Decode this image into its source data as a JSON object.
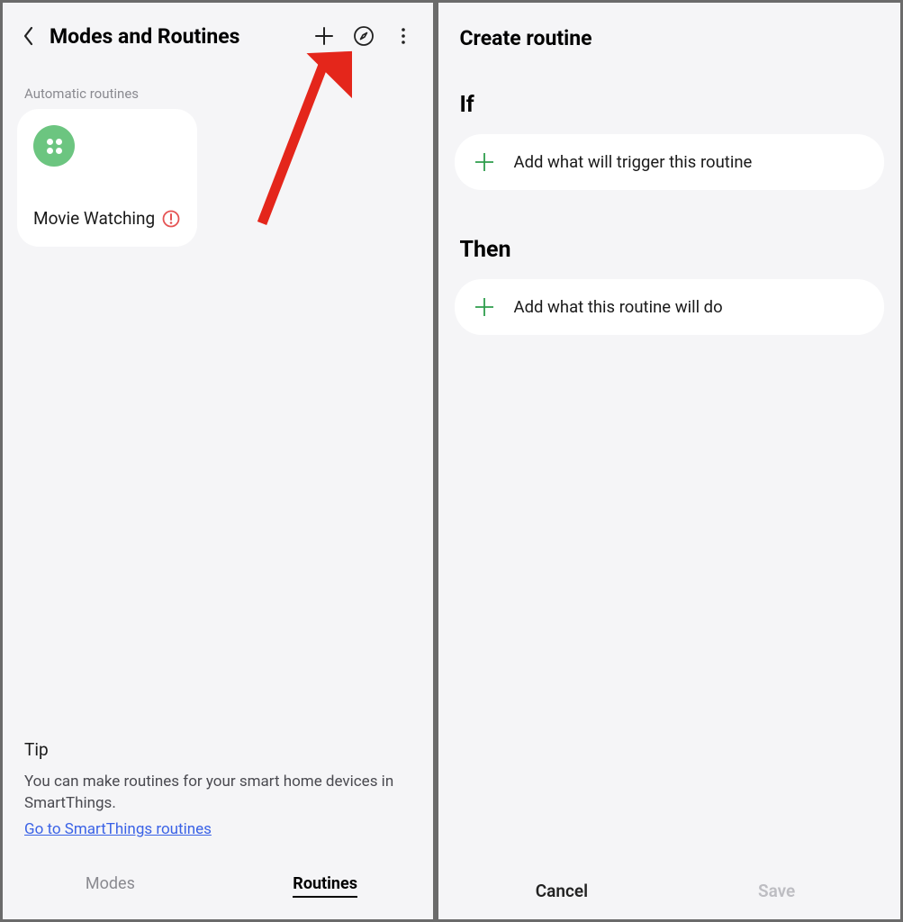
{
  "left": {
    "title": "Modes and Routines",
    "sectionLabel": "Automatic routines",
    "routine": {
      "name": "Movie Watching"
    },
    "tip": {
      "title": "Tip",
      "body": "You can make routines for your smart home devices in SmartThings.",
      "link": "Go to SmartThings routines"
    },
    "tabs": {
      "modes": "Modes",
      "routines": "Routines"
    }
  },
  "right": {
    "title": "Create routine",
    "if": {
      "heading": "If",
      "add": "Add what will trigger this routine"
    },
    "then": {
      "heading": "Then",
      "add": "Add what this routine will do"
    },
    "actions": {
      "cancel": "Cancel",
      "save": "Save"
    }
  },
  "colors": {
    "accentGreen": "#6cc580",
    "plusGreen": "#2e9d4c",
    "link": "#3a62e6",
    "errorRed": "#e55353",
    "annotationRed": "#e4261b"
  }
}
